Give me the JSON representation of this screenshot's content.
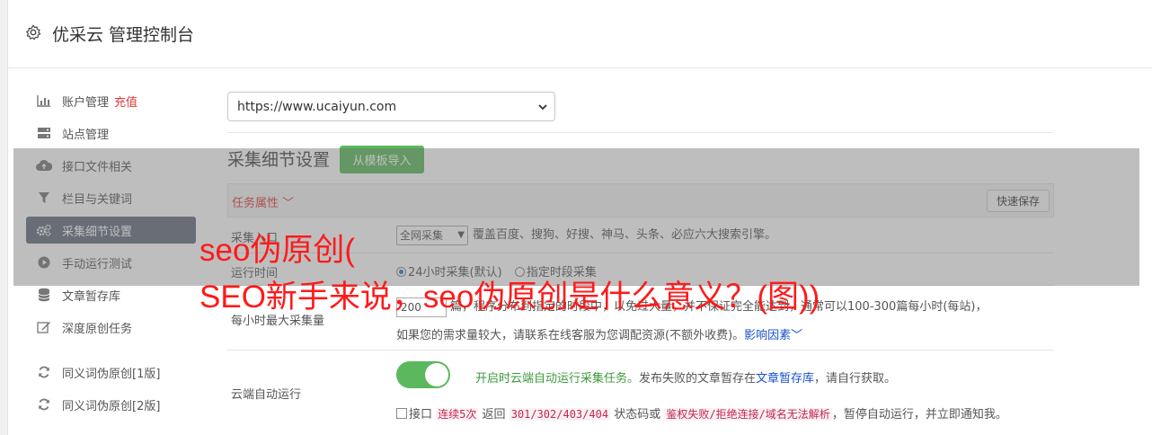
{
  "header": {
    "title": "优采云 管理控制台",
    "icon": "gear-icon"
  },
  "sidebar": {
    "items": [
      {
        "label": "账户管理",
        "badge": "充值",
        "icon": "bar-chart-icon"
      },
      {
        "label": "站点管理",
        "icon": "server-icon"
      },
      {
        "label": "接口文件相关",
        "icon": "cloud-upload-icon"
      },
      {
        "label": "栏目与关键词",
        "icon": "filter-icon"
      },
      {
        "label": "采集细节设置",
        "icon": "cogs-icon",
        "active": true
      },
      {
        "label": "手动运行测试",
        "icon": "play-circle-icon"
      },
      {
        "label": "文章暂存库",
        "icon": "database-icon"
      },
      {
        "label": "深度原创任务",
        "icon": "edit-icon"
      },
      {
        "label": "同义词伪原创[1版]",
        "icon": "refresh-icon"
      },
      {
        "label": "同义词伪原创[2版]",
        "icon": "refresh-icon"
      }
    ]
  },
  "site_select": {
    "value": "https://www.ucaiyun.com"
  },
  "section": {
    "title": "采集细节设置",
    "template_button": "从模板导入"
  },
  "panel": {
    "task_label": "任务属性 ",
    "quick_save": "快速保存"
  },
  "rows": {
    "mode": {
      "label": "采集入口",
      "select_value": "全网采集",
      "desc": "覆盖百度、搜狗、好搜、神马、头条、必应六大搜索引擎。"
    },
    "time": {
      "label": "运行时间",
      "opt1": "24小时采集(默认)",
      "opt2": "指定时段采集"
    },
    "max": {
      "label": "每小时最大采集量",
      "input_value": "200",
      "line1": "篇，程序分布到指定的时段中，以免过大量，并不保证完全能达到，通常可以100-300篇每小时(每站)，",
      "line2": "如果您的需求量较大，请联系在线客服为您调配资源(不额外收费)。",
      "link": "影响因素"
    },
    "cloud": {
      "label": "云端自动运行",
      "enabled_text": "开启时云端自动运行采集任务。",
      "desc_a": "发布失败的文章暂存在",
      "link": "文章暂存库",
      "desc_b": "，请自行获取。",
      "line2_a": "接口",
      "code1": "连续5次",
      "line2_b": "返回",
      "code2": "301/302/403/404",
      "line2_c": "状态码或",
      "code3": "鉴权失败/拒绝连接/域名无法解析",
      "line2_d": "，暂停自动运行，并立即通知我。"
    }
  },
  "watermark": {
    "line1": "seo伪原创(",
    "line2": "SEO新手来说，seo伪原创是什么意义？(图))"
  },
  "colors": {
    "accent_green": "#5cb85c",
    "active_nav": "#646d7c",
    "alert_red": "#e23a3a"
  }
}
